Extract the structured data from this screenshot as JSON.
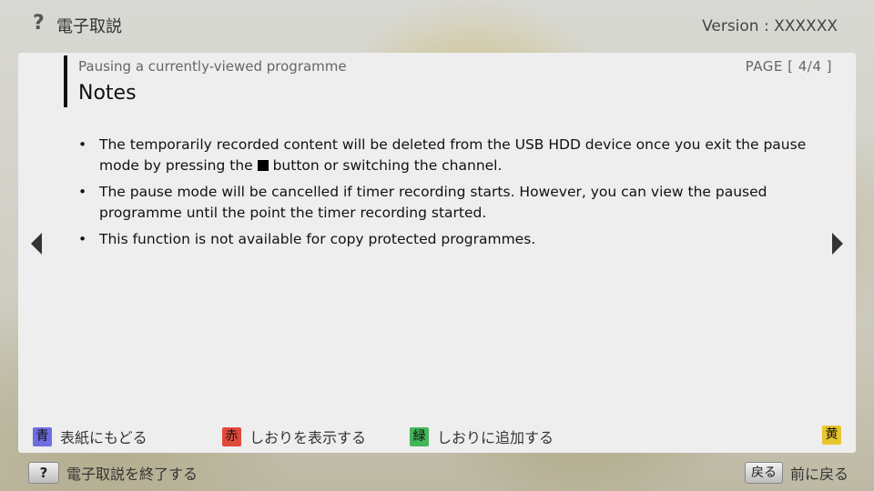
{
  "header": {
    "help_mark": "?",
    "title": "電子取説",
    "version": "Version : XXXXXX"
  },
  "panel": {
    "subtitle": "Pausing a currently-viewed programme",
    "heading": "Notes",
    "page_indicator": "PAGE [ 4/4 ]",
    "notes": [
      {
        "before_symbol": "The temporarily recorded content will be deleted from the USB HDD device once you exit the pause mode by pressing the ",
        "symbol": "stop-symbol",
        "after_symbol": " button or switching the channel."
      },
      {
        "text": "The pause mode will be cancelled if timer recording starts. However, you can view the paused programme until the point the timer recording started."
      },
      {
        "text": "This function is not available for copy protected programmes."
      }
    ]
  },
  "color_buttons": {
    "blue": {
      "key": "青",
      "label": "表紙にもどる",
      "color": "#6d6de0"
    },
    "red": {
      "key": "赤",
      "label": "しおりを表示する",
      "color": "#e04a3b"
    },
    "green": {
      "key": "緑",
      "label": "しおりに追加する",
      "color": "#44b65a"
    },
    "yellow": {
      "key": "黄",
      "color": "#e8c52c"
    }
  },
  "footer": {
    "exit": {
      "key": "?",
      "label": "電子取説を終了する"
    },
    "back": {
      "key": "戻る",
      "label": "前に戻る"
    }
  },
  "icons": {
    "prev": "arrow-left-icon",
    "next": "arrow-right-icon"
  }
}
